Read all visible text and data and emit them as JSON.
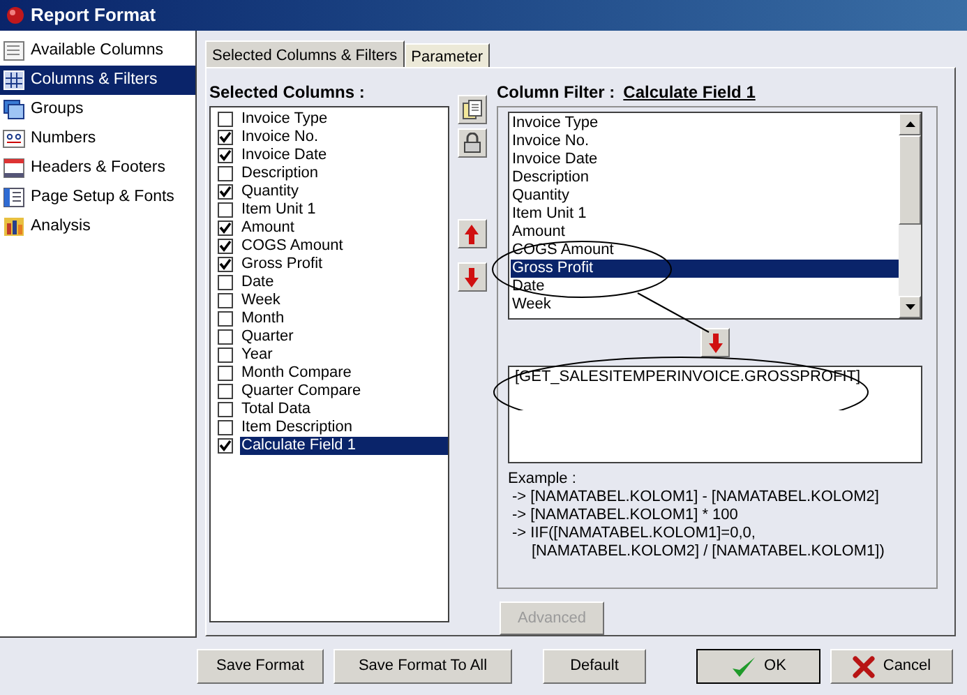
{
  "window": {
    "title": "Report Format"
  },
  "sidebar": {
    "items": [
      {
        "label": "Available Columns",
        "selected": false,
        "kind": "columns"
      },
      {
        "label": "Columns & Filters",
        "selected": true,
        "kind": "filters"
      },
      {
        "label": "Groups",
        "selected": false,
        "kind": "groups"
      },
      {
        "label": "Numbers",
        "selected": false,
        "kind": "numbers"
      },
      {
        "label": "Headers & Footers",
        "selected": false,
        "kind": "headers"
      },
      {
        "label": "Page Setup & Fonts",
        "selected": false,
        "kind": "page"
      },
      {
        "label": "Analysis",
        "selected": false,
        "kind": "analysis"
      }
    ]
  },
  "tabs": [
    {
      "label": "Selected Columns & Filters",
      "selected": true
    },
    {
      "label": "Parameter",
      "selected": false
    }
  ],
  "selected_columns": {
    "label": "Selected Columns :",
    "items": [
      {
        "label": "Invoice Type",
        "checked": false,
        "selected": false
      },
      {
        "label": "Invoice No.",
        "checked": true,
        "selected": false
      },
      {
        "label": "Invoice Date",
        "checked": true,
        "selected": false
      },
      {
        "label": "Description",
        "checked": false,
        "selected": false
      },
      {
        "label": "Quantity",
        "checked": true,
        "selected": false
      },
      {
        "label": "Item Unit 1",
        "checked": false,
        "selected": false
      },
      {
        "label": "Amount",
        "checked": true,
        "selected": false
      },
      {
        "label": "COGS Amount",
        "checked": true,
        "selected": false
      },
      {
        "label": "Gross Profit",
        "checked": true,
        "selected": false
      },
      {
        "label": "Date",
        "checked": false,
        "selected": false
      },
      {
        "label": "Week",
        "checked": false,
        "selected": false
      },
      {
        "label": "Month",
        "checked": false,
        "selected": false
      },
      {
        "label": "Quarter",
        "checked": false,
        "selected": false
      },
      {
        "label": "Year",
        "checked": false,
        "selected": false
      },
      {
        "label": "Month Compare",
        "checked": false,
        "selected": false
      },
      {
        "label": "Quarter Compare",
        "checked": false,
        "selected": false
      },
      {
        "label": "Total Data",
        "checked": false,
        "selected": false
      },
      {
        "label": "Item Description",
        "checked": false,
        "selected": false
      },
      {
        "label": "Calculate Field 1",
        "checked": true,
        "selected": true
      }
    ]
  },
  "column_filter": {
    "label": "Column Filter :",
    "column": "Calculate Field 1",
    "items": [
      {
        "label": "Invoice Type",
        "selected": false
      },
      {
        "label": "Invoice No.",
        "selected": false
      },
      {
        "label": "Invoice Date",
        "selected": false
      },
      {
        "label": "Description",
        "selected": false
      },
      {
        "label": "Quantity",
        "selected": false
      },
      {
        "label": "Item Unit 1",
        "selected": false
      },
      {
        "label": "Amount",
        "selected": false
      },
      {
        "label": "COGS Amount",
        "selected": false
      },
      {
        "label": "Gross Profit",
        "selected": true
      },
      {
        "label": "Date",
        "selected": false
      },
      {
        "label": "Week",
        "selected": false
      }
    ],
    "formula": "[GET_SALESITEMPERINVOICE.GROSSPROFIT]",
    "example_label": "Example :",
    "examples": [
      "-> [NAMATABEL.KOLOM1] - [NAMATABEL.KOLOM2]",
      "-> [NAMATABEL.KOLOM1] * 100",
      "-> IIF([NAMATABEL.KOLOM1]=0,0,",
      "[NAMATABEL.KOLOM2] / [NAMATABEL.KOLOM1])"
    ],
    "advanced": {
      "label": "Advanced",
      "disabled": true
    }
  },
  "footer_buttons": [
    {
      "label": "Save Format",
      "kind": "plain"
    },
    {
      "label": "Save Format To All",
      "kind": "plain"
    },
    {
      "label": "Default",
      "kind": "plain"
    },
    {
      "label": "OK",
      "kind": "ok"
    },
    {
      "label": "Cancel",
      "kind": "cancel"
    }
  ]
}
